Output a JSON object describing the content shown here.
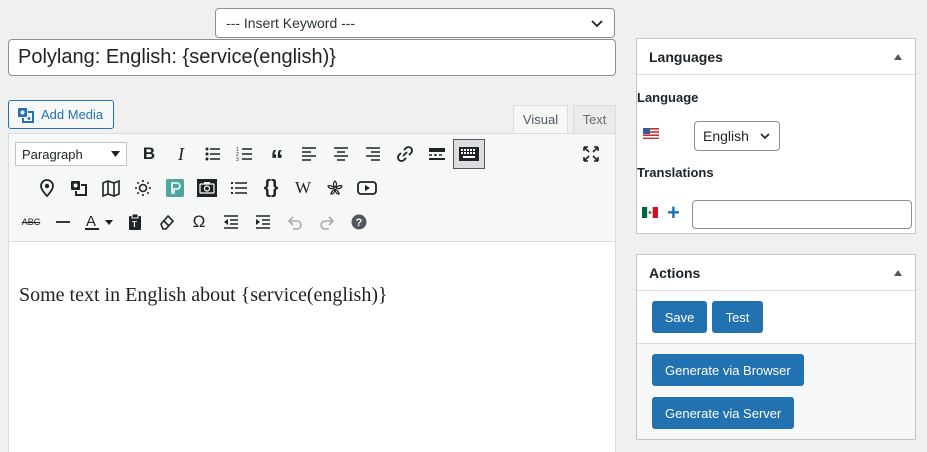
{
  "keyword": {
    "label": "--- Insert Keyword ---"
  },
  "title": {
    "value": "Polylang: English: {service(english)}"
  },
  "editor": {
    "add_media": "Add Media",
    "tabs": {
      "visual": "Visual",
      "text": "Text"
    },
    "format": "Paragraph",
    "content": "Some text in English about {service(english)}"
  },
  "languages": {
    "title": "Languages",
    "language_label": "Language",
    "language_value": "English",
    "translations_label": "Translations"
  },
  "actions": {
    "title": "Actions",
    "save": "Save",
    "test": "Test",
    "gen_browser": "Generate via Browser",
    "gen_server": "Generate via Server"
  },
  "colors": {
    "accent": "#2271b1",
    "background": "#f0f0f1"
  }
}
